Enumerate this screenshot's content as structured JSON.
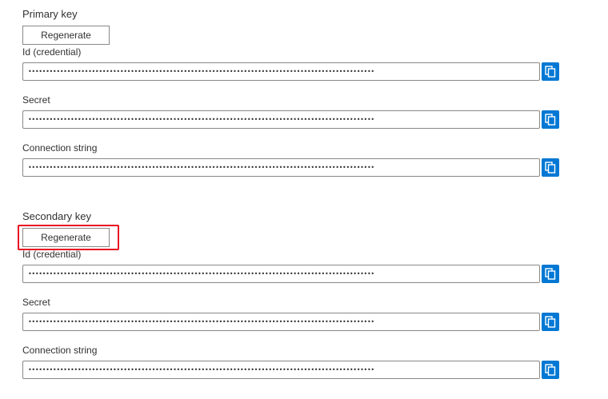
{
  "primary": {
    "title": "Primary key",
    "regenerate_label": "Regenerate",
    "fields": [
      {
        "label": "Id (credential)",
        "value": "••••••••••••••••••••••••••••••••••••••••••••••••••••••••••••••••••••••••••••••••••••••••••••••••••"
      },
      {
        "label": "Secret",
        "value": "••••••••••••••••••••••••••••••••••••••••••••••••••••••••••••••••••••••••••••••••••••••••••••••••••"
      },
      {
        "label": "Connection string",
        "value": "••••••••••••••••••••••••••••••••••••••••••••••••••••••••••••••••••••••••••••••••••••••••••••••••••"
      }
    ]
  },
  "secondary": {
    "title": "Secondary key",
    "regenerate_label": "Regenerate",
    "fields": [
      {
        "label": "Id (credential)",
        "value": "••••••••••••••••••••••••••••••••••••••••••••••••••••••••••••••••••••••••••••••••••••••••••••••••••"
      },
      {
        "label": "Secret",
        "value": "••••••••••••••••••••••••••••••••••••••••••••••••••••••••••••••••••••••••••••••••••••••••••••••••••"
      },
      {
        "label": "Connection string",
        "value": "••••••••••••••••••••••••••••••••••••••••••••••••••••••••••••••••••••••••••••••••••••••••••••••••••"
      }
    ]
  },
  "icons": {
    "copy": "copy-icon"
  },
  "colors": {
    "accent": "#0078d4",
    "highlight": "#e81123",
    "border": "#8a8886"
  }
}
